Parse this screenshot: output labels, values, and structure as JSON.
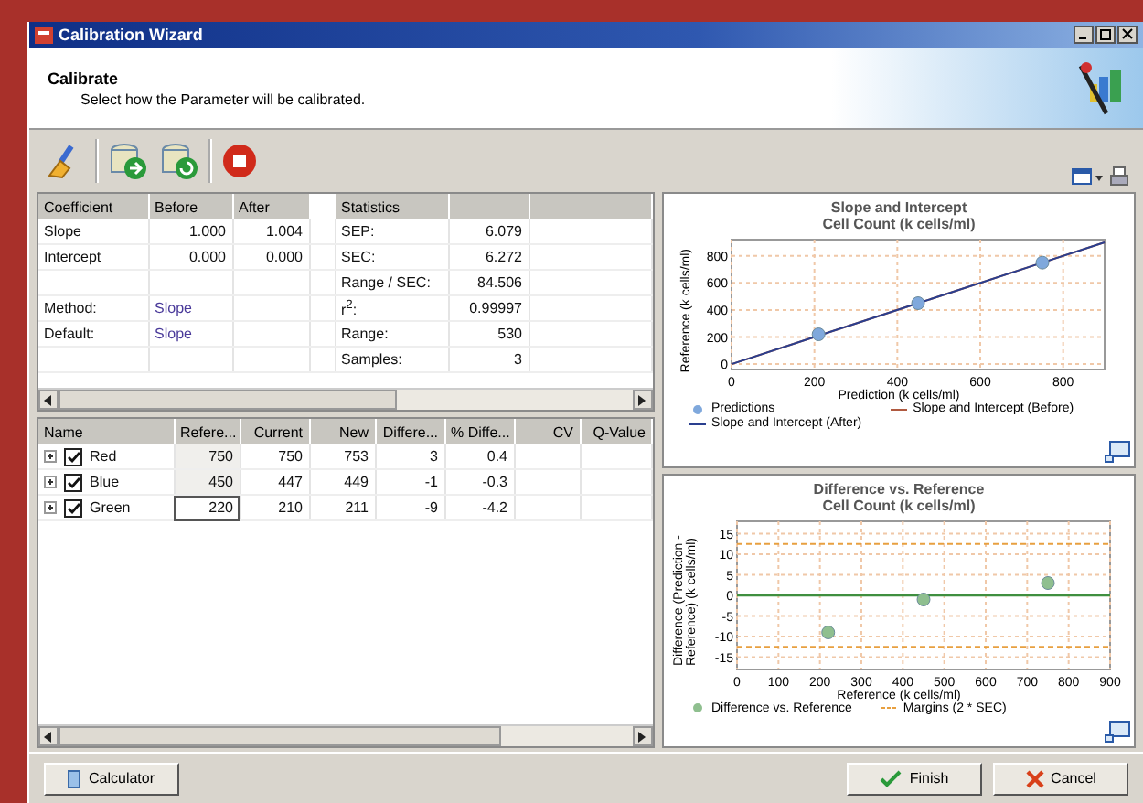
{
  "window": {
    "title": "Calibration Wizard"
  },
  "header": {
    "title": "Calibrate",
    "subtitle": "Select how the Parameter will be calibrated."
  },
  "coefficients": {
    "columns": [
      "Coefficient",
      "Before",
      "After"
    ],
    "statistics_title": "Statistics",
    "rows": [
      {
        "kind": "value",
        "coefficient": "Slope",
        "before": "1.000",
        "after": "1.004",
        "statistic": "SEP:",
        "value": "6.079"
      },
      {
        "kind": "value",
        "coefficient": "Intercept",
        "before": "0.000",
        "after": "0.000",
        "statistic": "SEC:",
        "value": "6.272"
      },
      {
        "kind": "empty",
        "statistic": "Range / SEC:",
        "value": "84.506"
      },
      {
        "kind": "setting",
        "coefficient": "Method:",
        "before": "Slope",
        "statistic": "r$^{2}$:",
        "value": "0.99997"
      },
      {
        "kind": "setting",
        "coefficient": "Default:",
        "before": "Slope",
        "statistic": "Range:",
        "value": "530"
      },
      {
        "kind": "empty",
        "statistic": "Samples:",
        "value": "3"
      }
    ]
  },
  "samples": {
    "columns": [
      "Name",
      "Refere...",
      "Current",
      "New",
      "Differe...",
      "% Diffe...",
      "CV",
      "Q-Value"
    ],
    "rows": [
      {
        "checked": true,
        "expanded": false,
        "focused": false,
        "cells": [
          "Red",
          "750",
          "750",
          "753",
          "3",
          "0.4"
        ]
      },
      {
        "checked": true,
        "expanded": false,
        "focused": false,
        "cells": [
          "Blue",
          "450",
          "447",
          "449",
          "-1",
          "-0.3"
        ]
      },
      {
        "checked": true,
        "expanded": false,
        "focused": true,
        "cells": [
          "Green",
          "220",
          "210",
          "211",
          "-9",
          "-4.2"
        ]
      }
    ]
  },
  "charts": [
    {
      "subtitle": "Cell Count (k cells/ml)",
      "chart_data": {
        "type": "scatter",
        "title": "Slope and Intercept",
        "xlabel": "Prediction (k cells/ml)",
        "ylabel": "Reference (k cells/ml)",
        "x": [
          0,
          210,
          450,
          750,
          900
        ],
        "xlim": [
          0,
          900
        ],
        "ylim": [
          -40,
          920
        ],
        "grid": true,
        "xticks": [
          0,
          200,
          400,
          600,
          800
        ],
        "yticks": [
          0,
          200,
          400,
          600,
          800
        ],
        "series": [
          {
            "name": "Predictions",
            "type": "scatter",
            "color": "#7fa8dc",
            "values": [
              null,
              220,
              450,
              750,
              null
            ]
          },
          {
            "name": "Slope and Intercept (Before)",
            "type": "line",
            "color": "#b05a40",
            "values": [
              0,
              210,
              450,
              750,
              900
            ]
          },
          {
            "name": "Slope and Intercept (After)",
            "type": "line",
            "color": "#2a3f8f",
            "values": [
              0,
              210,
              450,
              750,
              900
            ]
          }
        ]
      }
    },
    {
      "subtitle": "Cell Count (k cells/ml)",
      "chart_data": {
        "type": "scatter",
        "title": "Difference vs. Reference",
        "xlabel": "Reference (k cells/ml)",
        "ylabel": "Difference (Prediction - Reference) (k cells/ml)",
        "x": [
          220,
          450,
          750
        ],
        "xlim": [
          0,
          900
        ],
        "ylim": [
          -18,
          18
        ],
        "grid": true,
        "xticks": [
          0,
          100,
          200,
          300,
          400,
          500,
          600,
          700,
          800,
          900
        ],
        "yticks": [
          -15,
          -10,
          -5,
          0,
          5,
          10,
          15
        ],
        "series": [
          {
            "name": "Difference vs. Reference",
            "type": "scatter",
            "color": "#8fbf8f",
            "values": [
              -9,
              -1,
              3
            ]
          }
        ],
        "ref_lines": [
          {
            "axis": "y",
            "value": 0,
            "color": "#3f8f3f"
          },
          {
            "axis": "y",
            "value": 12.5,
            "color": "#e8a040",
            "label": "Margins (2 * SEC)"
          },
          {
            "axis": "y",
            "value": -12.5,
            "color": "#e8a040"
          }
        ]
      }
    }
  ],
  "buttons": {
    "calculator": "Calculator",
    "finish": "Finish",
    "cancel": "Cancel"
  }
}
